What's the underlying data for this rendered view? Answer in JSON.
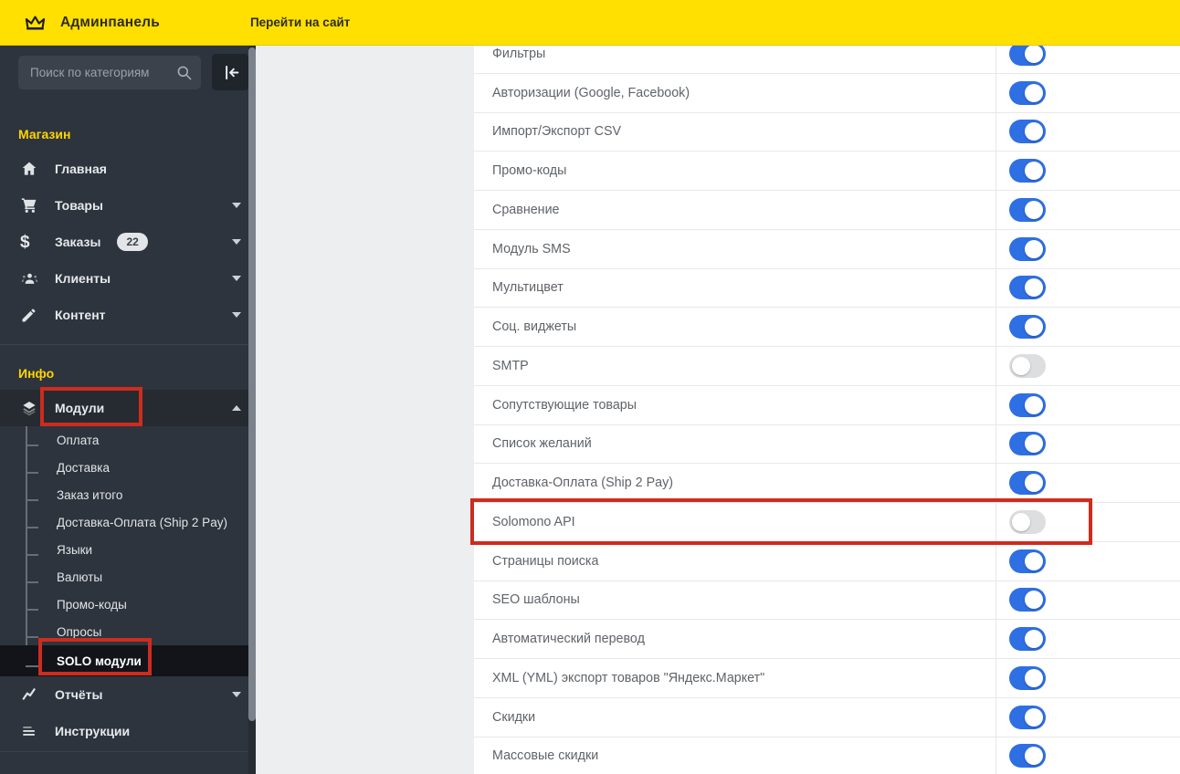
{
  "topbar": {
    "brand": "Админпанель",
    "site_link": "Перейти на сайт"
  },
  "sidebar": {
    "search_placeholder": "Поиск по категориям",
    "sections": [
      {
        "heading": "Магазин",
        "items": [
          {
            "key": "home",
            "icon": "home",
            "label": "Главная"
          },
          {
            "key": "products",
            "icon": "cart",
            "label": "Товары",
            "chevron": "down"
          },
          {
            "key": "orders",
            "icon": "dollar",
            "label": "Заказы",
            "badge": "22",
            "chevron": "down"
          },
          {
            "key": "customers",
            "icon": "people",
            "label": "Клиенты",
            "chevron": "down"
          },
          {
            "key": "content",
            "icon": "pencil",
            "label": "Контент",
            "chevron": "down"
          }
        ]
      },
      {
        "heading": "Инфо",
        "items": [
          {
            "key": "modules",
            "icon": "layers",
            "label": "Модули",
            "chevron": "up",
            "active": true,
            "active_child": 8,
            "children": [
              "Оплата",
              "Доставка",
              "Заказ итого",
              "Доставка-Оплата (Ship 2 Pay)",
              "Языки",
              "Валюты",
              "Промо-коды",
              "Опросы",
              "SOLO модули"
            ]
          },
          {
            "key": "reports",
            "icon": "chart",
            "label": "Отчёты",
            "chevron": "down"
          },
          {
            "key": "instructions",
            "icon": "list",
            "label": "Инструкции"
          }
        ]
      }
    ]
  },
  "modules": {
    "rows": [
      {
        "label": "Фильтры",
        "enabled": true
      },
      {
        "label": "Авторизации (Google, Facebook)",
        "enabled": true
      },
      {
        "label": "Импорт/Экспорт CSV",
        "enabled": true
      },
      {
        "label": "Промо-коды",
        "enabled": true
      },
      {
        "label": "Сравнение",
        "enabled": true
      },
      {
        "label": "Модуль SMS",
        "enabled": true
      },
      {
        "label": "Мультицвет",
        "enabled": true
      },
      {
        "label": "Соц. виджеты",
        "enabled": true
      },
      {
        "label": "SMTP",
        "enabled": false
      },
      {
        "label": "Сопутствующие товары",
        "enabled": true
      },
      {
        "label": "Список желаний",
        "enabled": true
      },
      {
        "label": "Доставка-Оплата (Ship 2 Pay)",
        "enabled": true
      },
      {
        "label": "Solomono API",
        "enabled": false,
        "highlighted": true
      },
      {
        "label": "Страницы поиска",
        "enabled": true
      },
      {
        "label": "SEO шаблоны",
        "enabled": true
      },
      {
        "label": "Автоматический перевод",
        "enabled": true
      },
      {
        "label": "XML (YML) экспорт товаров \"Яндекс.Маркет\"",
        "enabled": true
      },
      {
        "label": "Скидки",
        "enabled": true
      },
      {
        "label": "Массовые скидки",
        "enabled": true
      }
    ]
  },
  "colors": {
    "topbar": "#ffe000",
    "sidebar": "#2e343d",
    "sideactive": "#262b31",
    "sidesolo": "#12141a",
    "heading": "#ffd500",
    "blue": "#2e6fe3",
    "off": "#dcdee0",
    "red": "#cf2b1e",
    "border": "#e8e8e8",
    "label": "#5f6368"
  }
}
